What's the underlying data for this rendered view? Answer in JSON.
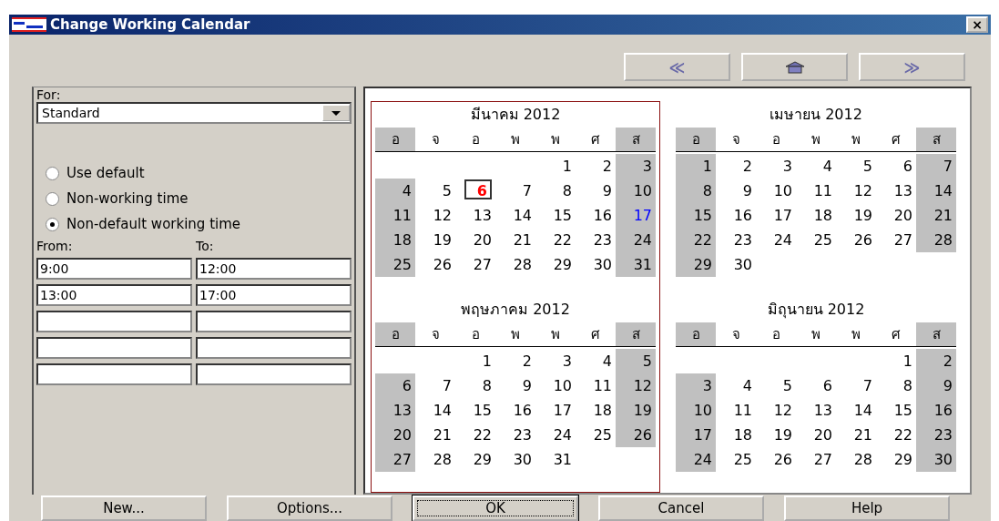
{
  "window": {
    "title": "Change Working Calendar",
    "close": "×"
  },
  "nav": {
    "previous": "≪",
    "next": "≫"
  },
  "left": {
    "for_label": "For:",
    "calendar": "Standard",
    "options": [
      {
        "label": "Use default",
        "selected": false
      },
      {
        "label": "Non-working time",
        "selected": false
      },
      {
        "label": "Non-default working time",
        "selected": true
      }
    ],
    "from_label": "From:",
    "to_label": "To:",
    "times": [
      {
        "from": "9:00",
        "to": "12:00"
      },
      {
        "from": "13:00",
        "to": "17:00"
      }
    ]
  },
  "months": [
    {
      "title": "มีนาคม 2012",
      "selected": true,
      "weekdays": [
        "อ",
        "จ",
        "อ",
        "พ",
        "พ",
        "ศ",
        "ส"
      ],
      "weeks": [
        [
          "1",
          "2",
          "3"
        ],
        [
          "4",
          "5",
          {
            "day": "6",
            "kind": "today"
          },
          "7",
          "8",
          "9",
          "10"
        ],
        [
          "11",
          "12",
          "13",
          "14",
          "15",
          "16",
          {
            "day": "17",
            "kind": "edited"
          }
        ],
        [
          "18",
          "19",
          "20",
          "21",
          "22",
          "23",
          "24"
        ],
        [
          "25",
          "26",
          "27",
          "28",
          "29",
          "30",
          "31"
        ]
      ]
    },
    {
      "title": "เมษายน 2012",
      "selected": false,
      "weekdays": [
        "อ",
        "จ",
        "อ",
        "พ",
        "พ",
        "ศ",
        "ส"
      ],
      "weeks": [
        [
          "1",
          "2",
          "3",
          "4",
          "5",
          "6",
          "7"
        ],
        [
          "8",
          "9",
          "10",
          "11",
          "12",
          "13",
          "14"
        ],
        [
          "15",
          "16",
          "17",
          "18",
          "19",
          "20",
          "21"
        ],
        [
          "22",
          "23",
          "24",
          "25",
          "26",
          "27",
          "28"
        ],
        [
          "29",
          "30"
        ]
      ]
    },
    {
      "title": "พฤษภาคม 2012",
      "selected": true,
      "weekdays": [
        "อ",
        "จ",
        "อ",
        "พ",
        "พ",
        "ศ",
        "ส"
      ],
      "weeks": [
        [
          "1",
          "2",
          "3",
          "4",
          "5"
        ],
        [
          "6",
          "7",
          "8",
          "9",
          "10",
          "11",
          "12"
        ],
        [
          "13",
          "14",
          "15",
          "16",
          "17",
          "18",
          "19"
        ],
        [
          "20",
          "21",
          "22",
          "23",
          "24",
          "25",
          "26"
        ],
        [
          "27",
          "28",
          "29",
          "30",
          "31"
        ]
      ]
    },
    {
      "title": "มิถุนายน 2012",
      "selected": false,
      "weekdays": [
        "อ",
        "จ",
        "อ",
        "พ",
        "พ",
        "ศ",
        "ส"
      ],
      "weeks": [
        [
          "1",
          "2"
        ],
        [
          "3",
          "4",
          "5",
          "6",
          "7",
          "8",
          "9"
        ],
        [
          "10",
          "11",
          "12",
          "13",
          "14",
          "15",
          "16"
        ],
        [
          "17",
          "18",
          "19",
          "20",
          "21",
          "22",
          "23"
        ],
        [
          "24",
          "25",
          "26",
          "27",
          "28",
          "29",
          "30"
        ]
      ]
    }
  ],
  "buttons": [
    {
      "label": "New...",
      "selected": false
    },
    {
      "label": "Options...",
      "selected": false
    },
    {
      "label": "OK",
      "selected": true
    },
    {
      "label": "Cancel",
      "selected": false
    },
    {
      "label": "Help",
      "selected": false
    }
  ]
}
